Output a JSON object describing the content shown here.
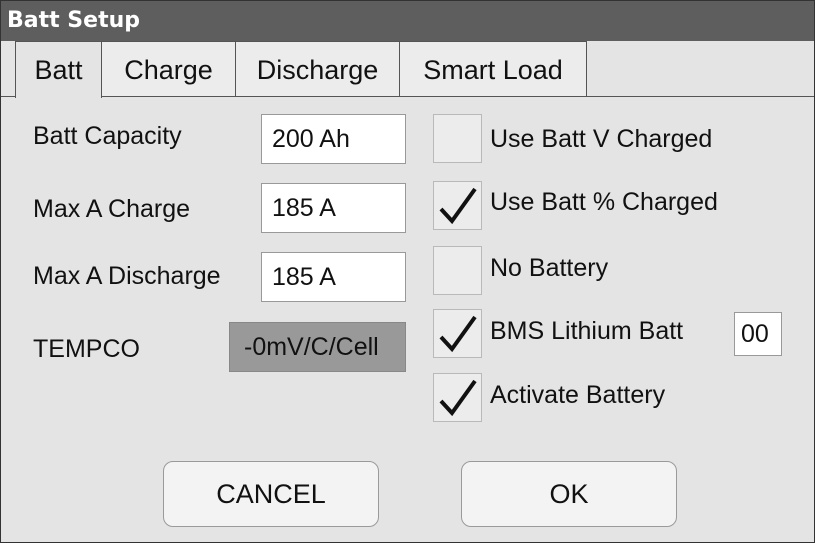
{
  "dialog": {
    "title": "Batt Setup"
  },
  "tabs": [
    {
      "label": "Batt",
      "active": true
    },
    {
      "label": "Charge",
      "active": false
    },
    {
      "label": "Discharge",
      "active": false
    },
    {
      "label": "Smart Load",
      "active": false
    }
  ],
  "fields": {
    "batt_capacity": {
      "label": "Batt Capacity",
      "value": "200 Ah"
    },
    "max_a_charge": {
      "label": "Max A Charge",
      "value": "185 A"
    },
    "max_a_discharge": {
      "label": "Max A Discharge",
      "value": "185 A"
    },
    "tempco": {
      "label": "TEMPCO",
      "value": "-0mV/C/Cell"
    }
  },
  "options": {
    "use_batt_v_charged": {
      "label": "Use Batt V Charged",
      "checked": false
    },
    "use_batt_pct_charged": {
      "label": "Use Batt % Charged",
      "checked": true
    },
    "no_battery": {
      "label": "No Battery",
      "checked": false
    },
    "bms_lithium_batt": {
      "label": "BMS Lithium Batt",
      "checked": true,
      "value": "00"
    },
    "activate_battery": {
      "label": "Activate Battery",
      "checked": true
    }
  },
  "buttons": {
    "cancel": "CANCEL",
    "ok": "OK"
  },
  "colors": {
    "title_bar": "#5e5e5e",
    "panel": "#e4e4e4",
    "readonly_field": "#999999"
  }
}
